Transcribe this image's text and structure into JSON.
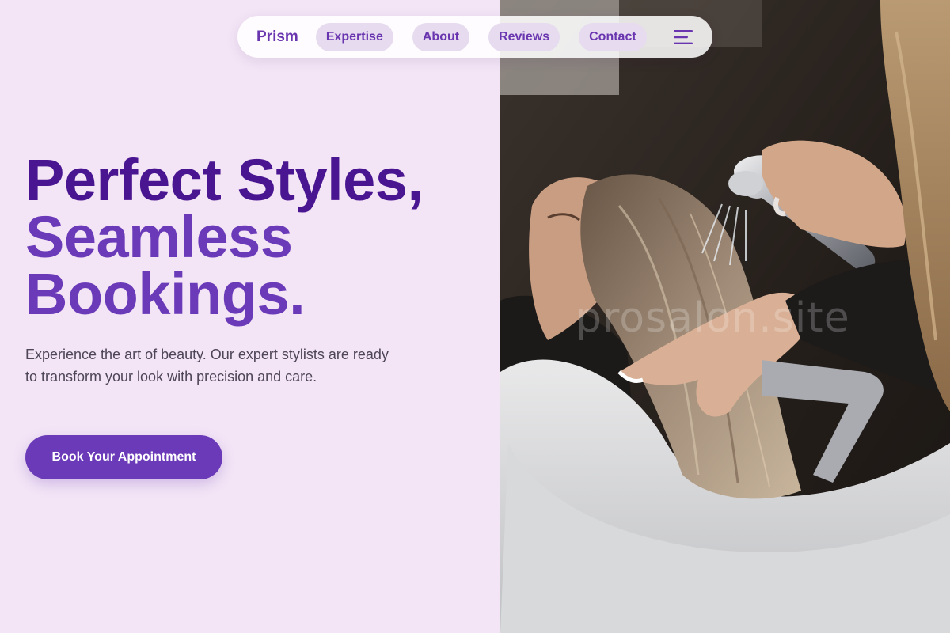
{
  "nav": {
    "brand": "Prism",
    "links": [
      {
        "label": "Expertise"
      },
      {
        "label": "About"
      },
      {
        "label": "Reviews"
      },
      {
        "label": "Contact"
      }
    ],
    "menu_icon": "hamburger-menu-icon"
  },
  "hero": {
    "title_line1": "Perfect Styles,",
    "title_line2": "Seamless",
    "title_line3": "Bookings.",
    "description": "Experience the art of beauty. Our expert stylists are ready to transform your look with precision and care.",
    "cta_label": "Book Your Appointment"
  },
  "photo": {
    "watermark": "prosalon.site",
    "subject": "stylist rinsing client's hair at salon wash basin"
  },
  "colors": {
    "background": "#f3e5f6",
    "accent": "#6b3ab8",
    "title_dark": "#4a1590",
    "nav_pill": "#e6dbef",
    "body_text": "#4d4558"
  }
}
